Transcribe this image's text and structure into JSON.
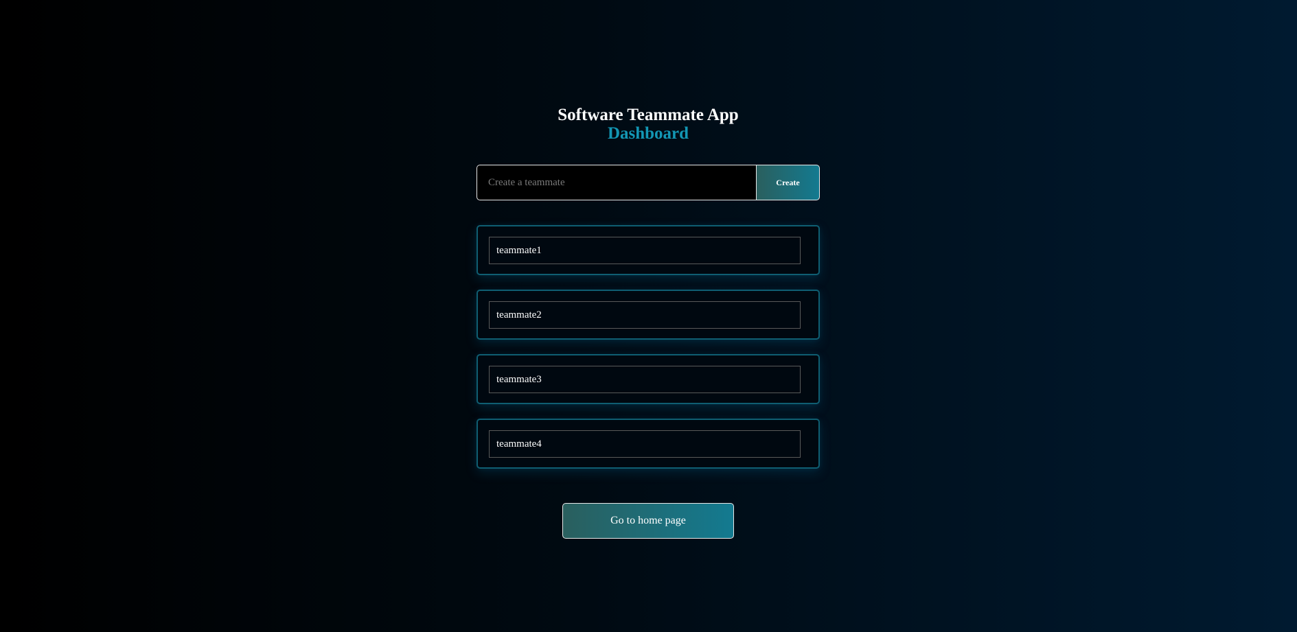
{
  "header": {
    "title": "Software Teammate App",
    "subtitle": "Dashboard"
  },
  "create_form": {
    "placeholder": "Create a teammate",
    "value": "",
    "button_label": "Create"
  },
  "teammates": [
    {
      "name": "teammate1"
    },
    {
      "name": "teammate2"
    },
    {
      "name": "teammate3"
    },
    {
      "name": "teammate4"
    }
  ],
  "footer": {
    "home_button_label": "Go to home page"
  },
  "colors": {
    "accent": "#1397b4",
    "card_border": "#0f5e72",
    "button_gradient_start": "#2a5f5e",
    "button_gradient_end": "#137a90"
  }
}
